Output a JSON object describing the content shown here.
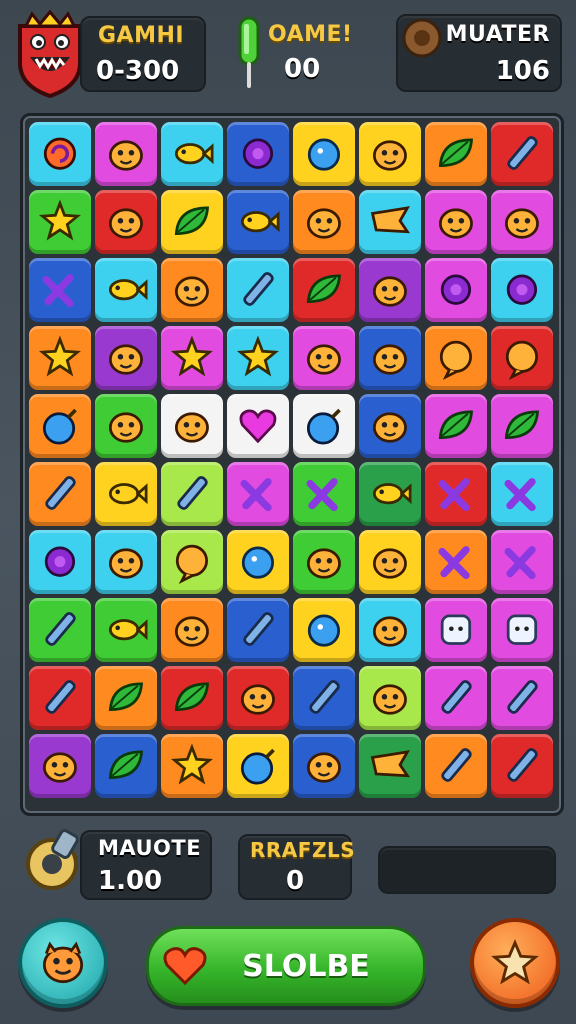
{
  "hud": {
    "player": {
      "label": "GAMHI",
      "value": "0-300"
    },
    "game": {
      "label": "OAME!",
      "value": "00"
    },
    "mutate": {
      "label": "MUATER",
      "value": "106"
    }
  },
  "board": {
    "rows": 10,
    "cols": 8,
    "colors": {
      "C": "#3ed0ef",
      "M": "#e24be0",
      "Y": "#ffd21f",
      "B": "#2a5fcf",
      "O": "#ff8a1f",
      "G": "#3fcc34",
      "R": "#e02a2a",
      "P": "#9a39d0",
      "L": "#a9e84a",
      "W": "#f4f4f4",
      "D": "#2aa04a"
    },
    "grid": [
      [
        "C",
        "M",
        "C",
        "B",
        "Y",
        "Y",
        "O",
        "R"
      ],
      [
        "G",
        "R",
        "Y",
        "B",
        "O",
        "C",
        "M",
        "M"
      ],
      [
        "B",
        "C",
        "O",
        "C",
        "R",
        "P",
        "M",
        "C"
      ],
      [
        "O",
        "P",
        "M",
        "C",
        "M",
        "B",
        "O",
        "R"
      ],
      [
        "O",
        "G",
        "W",
        "W",
        "W",
        "B",
        "M",
        "M"
      ],
      [
        "O",
        "Y",
        "L",
        "M",
        "G",
        "D",
        "R",
        "C"
      ],
      [
        "C",
        "C",
        "L",
        "Y",
        "G",
        "Y",
        "O",
        "M"
      ],
      [
        "G",
        "G",
        "O",
        "B",
        "Y",
        "C",
        "M",
        "M"
      ],
      [
        "R",
        "O",
        "R",
        "R",
        "B",
        "L",
        "M",
        "M"
      ],
      [
        "P",
        "B",
        "O",
        "Y",
        "B",
        "D",
        "O",
        "R"
      ]
    ],
    "icons": [
      [
        "swirl-icon",
        "creature-icon",
        "fish-icon",
        "flower-icon",
        "blob-icon",
        "creature-icon",
        "leaf-icon",
        "pen-icon"
      ],
      [
        "star-icon",
        "creature-icon",
        "leaf-icon",
        "fish-icon",
        "creature-icon",
        "flag-icon",
        "creature-icon",
        "creature-icon"
      ],
      [
        "cross-icon",
        "fish-icon",
        "creature-icon",
        "pen-icon",
        "leaf-icon",
        "creature-icon",
        "flower-icon",
        "flower-icon"
      ],
      [
        "star-icon",
        "creature-icon",
        "star-icon",
        "star-icon",
        "creature-icon",
        "creature-icon",
        "bubble-icon",
        "bubble-icon"
      ],
      [
        "bomb-icon",
        "creature-icon",
        "creature-icon",
        "heart-icon",
        "bomb-icon",
        "creature-icon",
        "leaf-icon",
        "leaf-icon"
      ],
      [
        "pen-icon",
        "fish-icon",
        "pen-icon",
        "cross-icon",
        "cross-icon",
        "fish-icon",
        "cross-icon",
        "cross-icon"
      ],
      [
        "flower-icon",
        "creature-icon",
        "bubble-icon",
        "blob-icon",
        "creature-icon",
        "creature-icon",
        "cross-icon",
        "cross-icon"
      ],
      [
        "pen-icon",
        "fish-icon",
        "creature-icon",
        "pen-icon",
        "blob-icon",
        "creature-icon",
        "ghost-icon",
        "ghost-icon"
      ],
      [
        "pen-icon",
        "leaf-icon",
        "leaf-icon",
        "creature-icon",
        "pen-icon",
        "creature-icon",
        "pen-icon",
        "pen-icon"
      ],
      [
        "creature-icon",
        "leaf-icon",
        "star-icon",
        "bomb-icon",
        "creature-icon",
        "flag-icon",
        "pen-icon",
        "pen-icon"
      ]
    ]
  },
  "bottom": {
    "maute": {
      "label": "MAUOTE",
      "value": "1.00"
    },
    "rrafzls": {
      "label": "RRAFZLS",
      "value": "0"
    },
    "play_label": "SLOLBE"
  },
  "colors": {
    "accent": "#f6c945",
    "panel": "#262d33",
    "play_green": "#36b52a"
  }
}
